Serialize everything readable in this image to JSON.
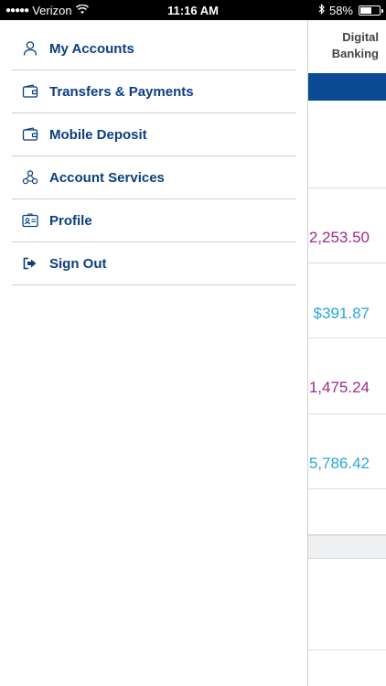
{
  "status_bar": {
    "carrier": "Verizon",
    "time": "11:16 AM",
    "battery": "58%"
  },
  "background": {
    "header_title": "Digital Banking",
    "amounts": [
      {
        "value": "2,253.50",
        "color": "#9b2b8f"
      },
      {
        "value": "$391.87",
        "color": "#2aa7d8"
      },
      {
        "value": "1,475.24",
        "color": "#9b2b8f"
      },
      {
        "value": "5,786.42",
        "color": "#2aa7d8"
      }
    ]
  },
  "menu": {
    "items": [
      {
        "label": "My Accounts",
        "icon": "user-icon"
      },
      {
        "label": "Transfers & Payments",
        "icon": "wallet-icon"
      },
      {
        "label": "Mobile Deposit",
        "icon": "wallet-icon"
      },
      {
        "label": "Account Services",
        "icon": "services-icon"
      },
      {
        "label": "Profile",
        "icon": "id-card-icon"
      },
      {
        "label": "Sign Out",
        "icon": "sign-out-icon"
      }
    ]
  },
  "colors": {
    "accent": "#0b3f80",
    "header_bar": "#0a4a93"
  }
}
